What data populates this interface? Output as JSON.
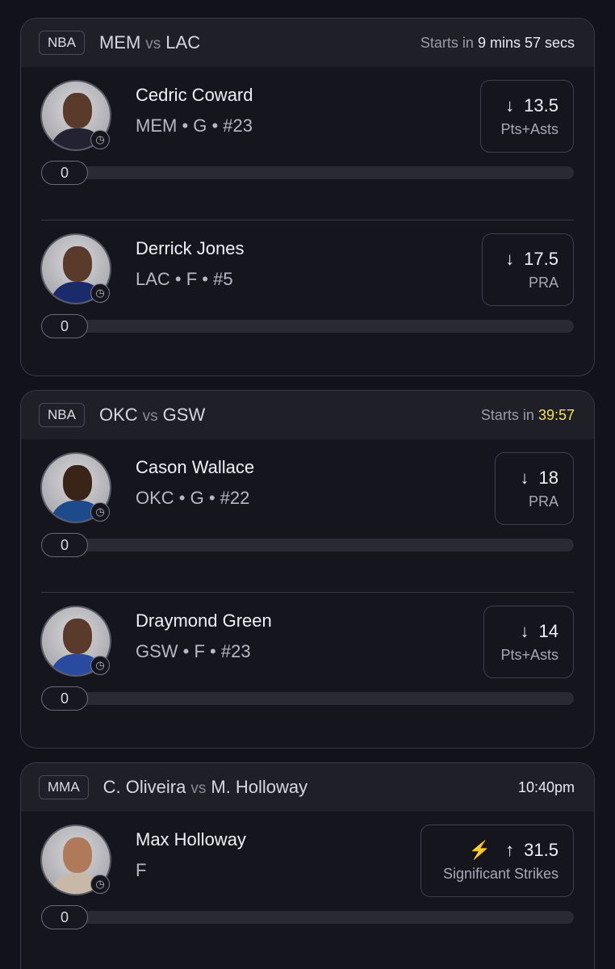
{
  "games": [
    {
      "league": "NBA",
      "team_a": "MEM",
      "vs": "vs",
      "team_b": "LAC",
      "start_prefix": "Starts in",
      "start_time": "9 mins 57 secs",
      "players": [
        {
          "name": "Cedric Coward",
          "meta": "MEM • G • #23",
          "direction": "down",
          "line": "13.5",
          "stat": "Pts+Asts",
          "progress_value": "0"
        },
        {
          "name": "Derrick Jones",
          "meta": "LAC • F • #5",
          "direction": "down",
          "line": "17.5",
          "stat": "PRA",
          "progress_value": "0"
        }
      ]
    },
    {
      "league": "NBA",
      "team_a": "OKC",
      "vs": "vs",
      "team_b": "GSW",
      "start_prefix": "Starts in",
      "start_time": "39:57",
      "players": [
        {
          "name": "Cason Wallace",
          "meta": "OKC • G • #22",
          "direction": "down",
          "line": "18",
          "stat": "PRA",
          "progress_value": "0"
        },
        {
          "name": "Draymond Green",
          "meta": "GSW • F • #23",
          "direction": "down",
          "line": "14",
          "stat": "Pts+Asts",
          "progress_value": "0"
        }
      ]
    },
    {
      "league": "MMA",
      "team_a": "C. Oliveira",
      "vs": "vs",
      "team_b": "M. Holloway",
      "start_prefix": "",
      "start_time": "10:40pm",
      "players": [
        {
          "name": "Max Holloway",
          "meta": "F",
          "direction": "up",
          "line": "31.5",
          "stat": "Significant Strikes",
          "progress_value": "0",
          "boost_icon": "lightning-bolt-icon"
        }
      ]
    }
  ],
  "colors": {
    "countdown_highlight": "#f3e15a",
    "boost": "#f0c030"
  }
}
